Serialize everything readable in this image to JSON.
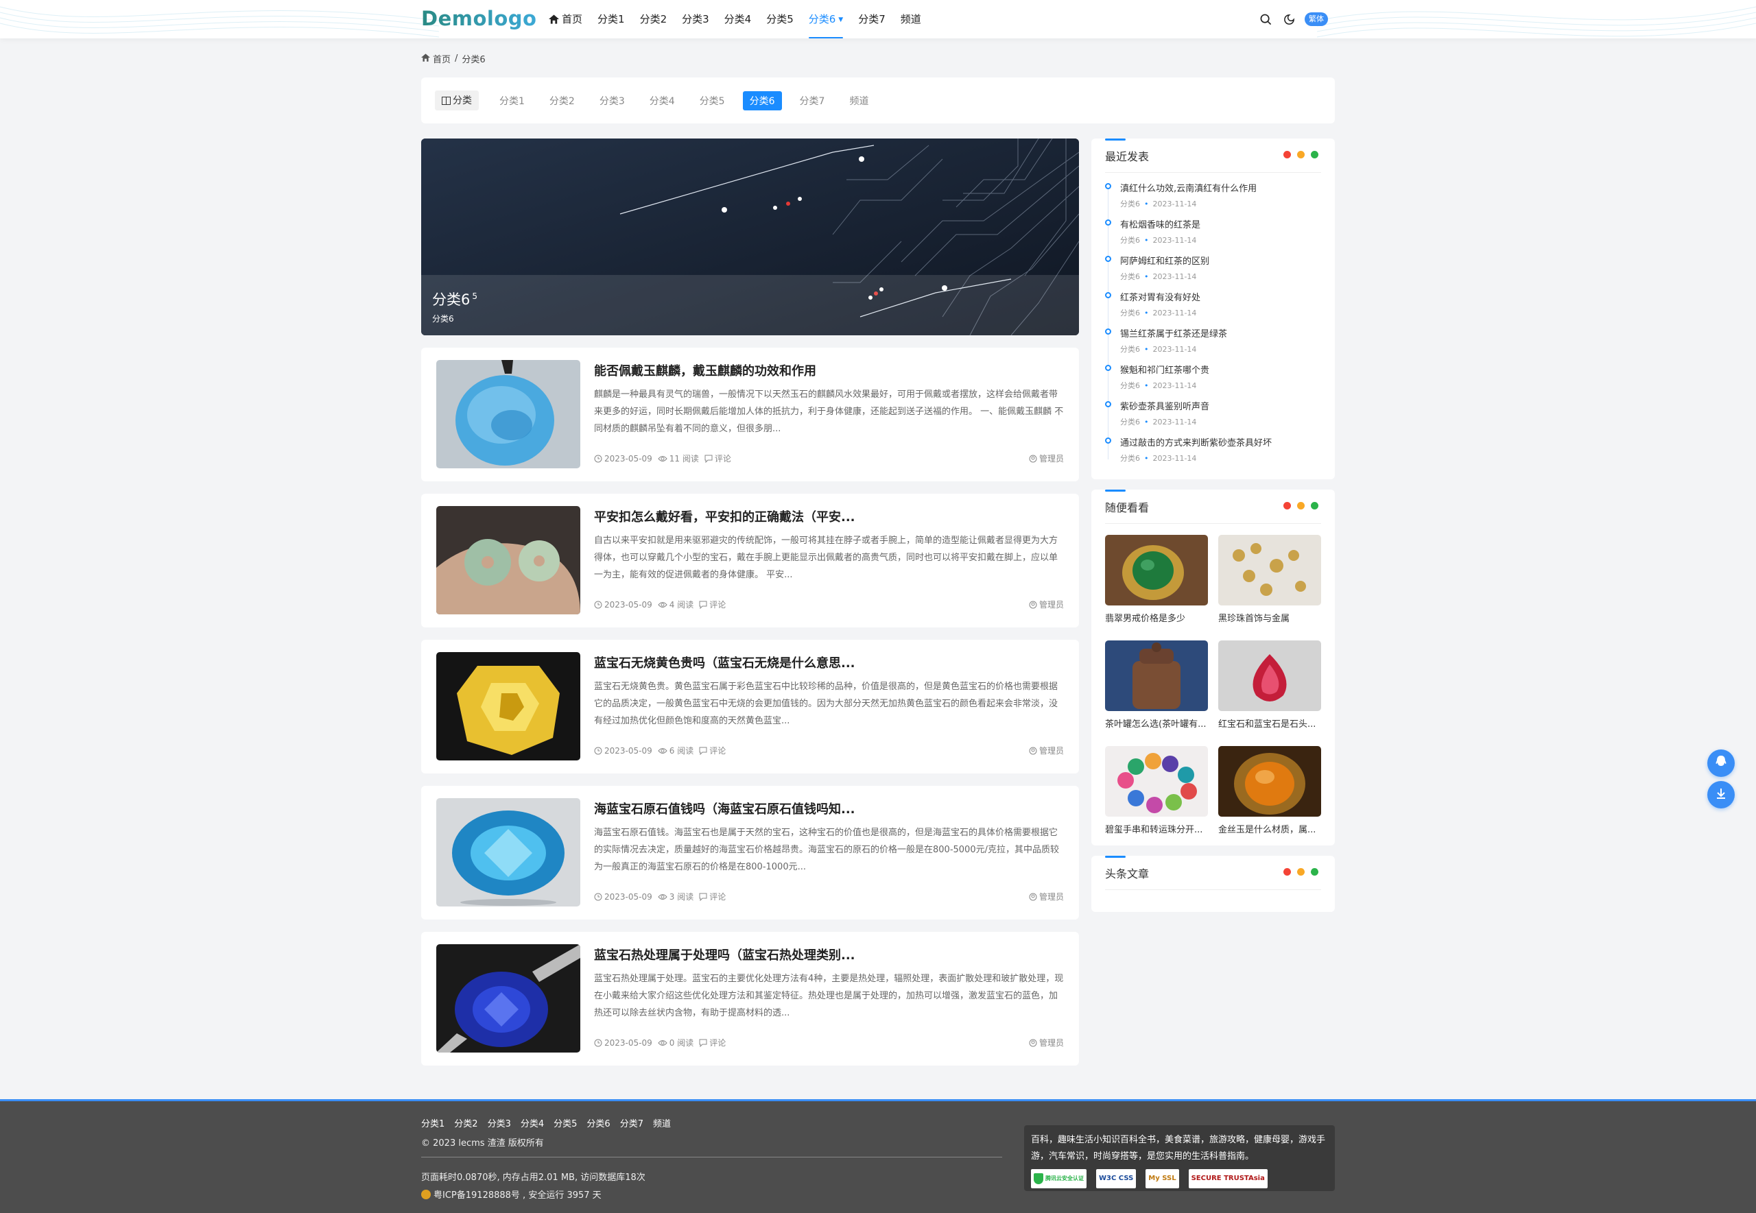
{
  "colors": {
    "accent": "#1a8cff",
    "float": "#3a8ef6",
    "footer_bg": "#4d4d4d",
    "dot_red": "#f44336",
    "dot_yellow": "#f9a825",
    "dot_green": "#2bb34a"
  },
  "header": {
    "logo": "Demologo",
    "nav": [
      {
        "label": "首页",
        "icon": "home-icon"
      },
      {
        "label": "分类1"
      },
      {
        "label": "分类2"
      },
      {
        "label": "分类3"
      },
      {
        "label": "分类4"
      },
      {
        "label": "分类5"
      },
      {
        "label": "分类6",
        "active": true,
        "dropdown": true
      },
      {
        "label": "分类7"
      },
      {
        "label": "频道"
      }
    ],
    "icons": [
      "search-icon",
      "night-mode-icon"
    ],
    "lang": "繁体"
  },
  "breadcrumb": {
    "home": "首页",
    "sep": "/",
    "current": "分类6"
  },
  "tabbar": {
    "label": "分类",
    "tabs": [
      "分类1",
      "分类2",
      "分类3",
      "分类4",
      "分类5",
      "分类6",
      "分类7",
      "频道"
    ],
    "active": "分类6"
  },
  "banner": {
    "title": "分类6",
    "badge": "5",
    "subtitle": "分类6"
  },
  "articles": [
    {
      "title": "能否佩戴玉麒麟，戴玉麒麟的功效和作用",
      "desc": "麒麟是一种最具有灵气的瑞兽，一般情况下以天然玉石的麒麟风水效果最好，可用于佩戴或者摆放，这样会给佩戴者带来更多的好运，同时长期佩戴后能增加人体的抵抗力，利于身体健康，还能起到送子送福的作用。 一、能佩戴玉麒麟 不同材质的麒麟吊坠有着不同的意义，但很多朋...",
      "date": "2023-05-09",
      "views": "11 阅读",
      "comments": "评论",
      "author": "管理员"
    },
    {
      "title": "平安扣怎么戴好看，平安扣的正确戴法（平安...",
      "desc": "自古以来平安扣就是用来驱邪避灾的传统配饰，一般可将其挂在脖子或者手腕上，简单的造型能让佩戴者显得更为大方得体，也可以穿戴几个小型的宝石，戴在手腕上更能显示出佩戴者的高贵气质，同时也可以将平安扣戴在脚上，应以单一为主，能有效的促进佩戴者的身体健康。 平安...",
      "date": "2023-05-09",
      "views": "4 阅读",
      "comments": "评论",
      "author": "管理员"
    },
    {
      "title": "蓝宝石无烧黄色贵吗（蓝宝石无烧是什么意思...",
      "desc": "蓝宝石无烧黄色贵。黄色蓝宝石属于彩色蓝宝石中比较珍稀的品种，价值是很高的，但是黄色蓝宝石的价格也需要根据它的品质决定，一般黄色蓝宝石中无烧的会更加值钱的。因为大部分天然无加热黄色蓝宝石的颜色看起来会非常淡，没有经过加热优化但颜色饱和度高的天然黄色蓝宝...",
      "date": "2023-05-09",
      "views": "6 阅读",
      "comments": "评论",
      "author": "管理员"
    },
    {
      "title": "海蓝宝石原石值钱吗（海蓝宝石原石值钱吗知...",
      "desc": "海蓝宝石原石值钱。海蓝宝石也是属于天然的宝石，这种宝石的价值也是很高的，但是海蓝宝石的具体价格需要根据它的实际情况去决定，质量越好的海蓝宝石价格越昂贵。海蓝宝石的原石的价格一般是在800-5000元/克拉，其中品质较为一般真正的海蓝宝石原石的价格是在800-1000元...",
      "date": "2023-05-09",
      "views": "3 阅读",
      "comments": "评论",
      "author": "管理员"
    },
    {
      "title": "蓝宝石热处理属于处理吗（蓝宝石热处理类别...",
      "desc": "蓝宝石热处理属于处理。蓝宝石的主要优化处理方法有4种，主要是热处理，辐照处理，表面扩散处理和玻扩散处理，现在小戴来给大家介绍这些优化处理方法和其鉴定特征。热处理也是属于处理的，加热可以增强，激发蓝宝石的蓝色，加热还可以除去丝状内含物，有助于提高材料的透...",
      "date": "2023-05-09",
      "views": "0 阅读",
      "comments": "评论",
      "author": "管理员"
    }
  ],
  "sidebar": {
    "recent": {
      "title": "最近发表",
      "items": [
        {
          "title": "滇红什么功效,云南滇红有什么作用",
          "cat": "分类6",
          "date": "2023-11-14"
        },
        {
          "title": "有松烟香味的红茶是",
          "cat": "分类6",
          "date": "2023-11-14"
        },
        {
          "title": "阿萨姆红和红茶的区别",
          "cat": "分类6",
          "date": "2023-11-14"
        },
        {
          "title": "红茶对胃有没有好处",
          "cat": "分类6",
          "date": "2023-11-14"
        },
        {
          "title": "锡兰红茶属于红茶还是绿茶",
          "cat": "分类6",
          "date": "2023-11-14"
        },
        {
          "title": "猴魁和祁门红茶哪个贵",
          "cat": "分类6",
          "date": "2023-11-14"
        },
        {
          "title": "紫砂壶茶具鉴别听声音",
          "cat": "分类6",
          "date": "2023-11-14"
        },
        {
          "title": "通过敲击的方式来判断紫砂壶茶具好坏",
          "cat": "分类6",
          "date": "2023-11-14"
        }
      ]
    },
    "random": {
      "title": "随便看看",
      "items": [
        {
          "title": "翡翠男戒价格是多少"
        },
        {
          "title": "黑珍珠首饰与金属"
        },
        {
          "title": "茶叶罐怎么选(茶叶罐有..."
        },
        {
          "title": "红宝石和蓝宝石是石头..."
        },
        {
          "title": "碧玺手串和转运珠分开..."
        },
        {
          "title": "金丝玉是什么材质，属..."
        }
      ]
    },
    "headline": {
      "title": "头条文章"
    }
  },
  "float_buttons": [
    "qq-icon",
    "download-icon"
  ],
  "footer": {
    "links": [
      "分类1",
      "分类2",
      "分类3",
      "分类4",
      "分类5",
      "分类6",
      "分类7",
      "频道"
    ],
    "copyright": "© 2023 lecms 渣渣 版权所有",
    "stats": "页面耗时0.0870秒, 内存占用2.01 MB, 访问数据库18次",
    "icp": "粤ICP备19128888号 , 安全运行 3957 天",
    "about": "百科，趣味生活小知识百科全书，美食菜谱，旅游攻略，健康母婴，游戏手游，汽车常识，时尚穿搭等，是您实用的生活科普指南。",
    "badges": [
      "腾讯云安全认证",
      "W3C CSS",
      "My SSL",
      "SECURE TRUSTAsia"
    ]
  }
}
